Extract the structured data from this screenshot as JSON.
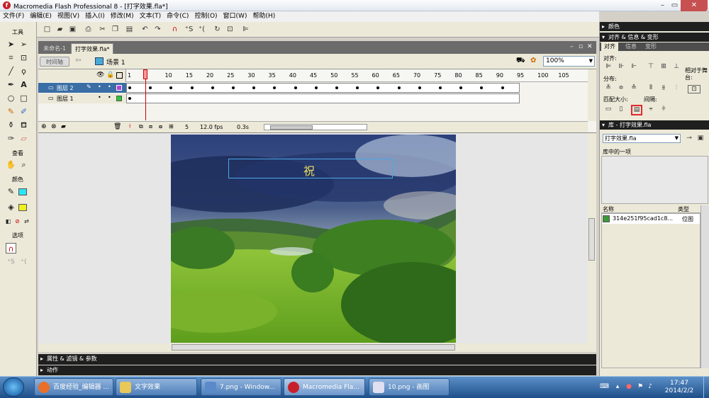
{
  "window": {
    "title": "Macromedia Flash Professional 8 - [打字效果.fla*]",
    "app_icon": "f"
  },
  "menu": [
    "文件(F)",
    "编辑(E)",
    "视图(V)",
    "插入(I)",
    "修改(M)",
    "文本(T)",
    "命令(C)",
    "控制(O)",
    "窗口(W)",
    "帮助(H)"
  ],
  "tools": {
    "heading": "工具",
    "view_heading": "查看",
    "colors_heading": "颜色",
    "options_heading": "选项"
  },
  "document": {
    "tabs": [
      "未命名-1",
      "打字效果.fla*"
    ],
    "timeline_button": "时间轴",
    "scene": "场景 1",
    "zoom": "100%"
  },
  "timeline": {
    "frame_numbers": [
      "1",
      "5",
      "10",
      "15",
      "20",
      "25",
      "30",
      "35",
      "40",
      "45",
      "50",
      "55",
      "60",
      "65",
      "70",
      "75",
      "80",
      "85",
      "90",
      "95",
      "100",
      "105"
    ],
    "layers": [
      {
        "name": "图层 2",
        "selected": true
      },
      {
        "name": "图层 1",
        "selected": false
      }
    ],
    "current_frame": "5",
    "fps": "12.0 fps",
    "time": "0.3s"
  },
  "stage": {
    "text_char": "祝"
  },
  "bottom_panels": {
    "properties": "属性 & 滤镜 & 参数",
    "actions": "动作"
  },
  "right_panel": {
    "color_head": "颜色",
    "align_head": "对齐 & 信息 & 变形",
    "tabs": [
      "对齐",
      "信息",
      "变形"
    ],
    "align_label": "对齐:",
    "distribute_label": "分布:",
    "match_size_label": "匹配大小:",
    "spacing_label": "间隔:",
    "relative_label": "相对于舞台:",
    "library_head": "库 - 打字效果.fla",
    "library_select": "打字效果.fla",
    "library_count": "库中的一项",
    "col_name": "名称",
    "col_type": "类型",
    "item_name": "314e251f95cad1c8...",
    "item_type": "位图"
  },
  "taskbar": {
    "tasks": [
      "百度经验_编辑器 ...",
      "文字效果",
      "7.png - Window...",
      "Macromedia Fla...",
      "10.png - 画图"
    ],
    "time": "17:47",
    "date": "2014/2/2"
  },
  "colors": {
    "accent_highlight": "#e0282d",
    "stage_text": "#e8e060"
  }
}
